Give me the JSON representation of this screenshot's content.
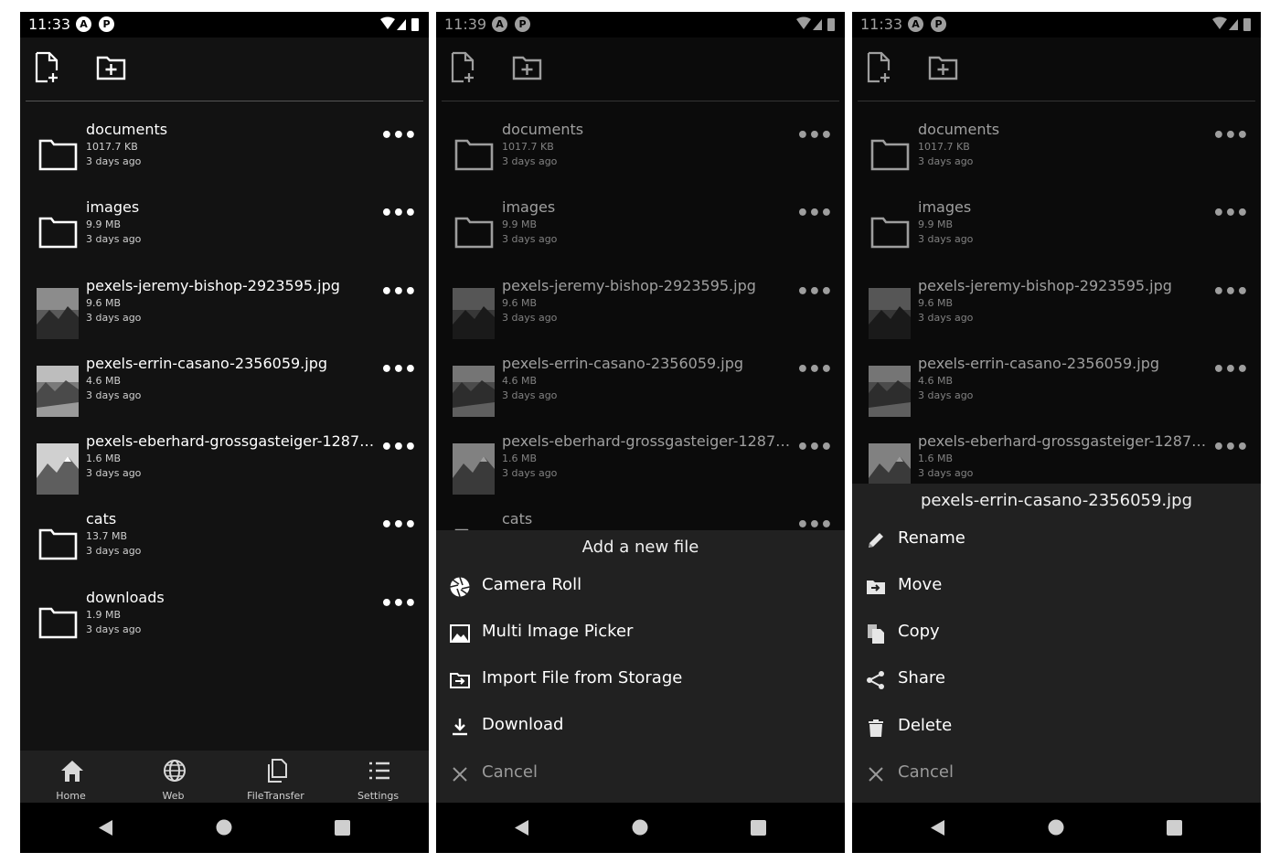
{
  "phones": [
    {
      "time": "11:33",
      "files": [
        {
          "name": "documents",
          "size": "1017.7 KB",
          "date": "3 days ago",
          "kind": "folder"
        },
        {
          "name": "images",
          "size": "9.9 MB",
          "date": "3 days ago",
          "kind": "folder"
        },
        {
          "name": "pexels-jeremy-bishop-2923595.jpg",
          "size": "9.6 MB",
          "date": "3 days ago",
          "kind": "image"
        },
        {
          "name": "pexels-errin-casano-2356059.jpg",
          "size": "4.6 MB",
          "date": "3 days ago",
          "kind": "image"
        },
        {
          "name": "pexels-eberhard-grossgasteiger-1287…",
          "size": "1.6 MB",
          "date": "3 days ago",
          "kind": "image"
        },
        {
          "name": "cats",
          "size": "13.7 MB",
          "date": "3 days ago",
          "kind": "folder"
        },
        {
          "name": "downloads",
          "size": "1.9 MB",
          "date": "3 days ago",
          "kind": "folder"
        }
      ],
      "nav": [
        {
          "label": "Home",
          "icon": "home-icon"
        },
        {
          "label": "Web",
          "icon": "globe-icon"
        },
        {
          "label": "FileTransfer",
          "icon": "files-icon"
        },
        {
          "label": "Settings",
          "icon": "list-icon"
        }
      ]
    },
    {
      "time": "11:39",
      "files": [
        {
          "name": "documents",
          "size": "1017.7 KB",
          "date": "3 days ago",
          "kind": "folder"
        },
        {
          "name": "images",
          "size": "9.9 MB",
          "date": "3 days ago",
          "kind": "folder"
        },
        {
          "name": "pexels-jeremy-bishop-2923595.jpg",
          "size": "9.6 MB",
          "date": "3 days ago",
          "kind": "image"
        },
        {
          "name": "pexels-errin-casano-2356059.jpg",
          "size": "4.6 MB",
          "date": "3 days ago",
          "kind": "image"
        },
        {
          "name": "pexels-eberhard-grossgasteiger-1287…",
          "size": "1.6 MB",
          "date": "3 days ago",
          "kind": "image"
        },
        {
          "name": "cats",
          "size": "",
          "date": "",
          "kind": "folder"
        }
      ],
      "sheet": {
        "title": "Add a new file",
        "items": [
          {
            "label": "Camera Roll",
            "icon": "aperture-icon"
          },
          {
            "label": "Multi Image Picker",
            "icon": "image-icon"
          },
          {
            "label": "Import File from Storage",
            "icon": "folder-import-icon"
          },
          {
            "label": "Download",
            "icon": "download-icon"
          },
          {
            "label": "Cancel",
            "icon": "close-icon"
          }
        ]
      }
    },
    {
      "time": "11:33",
      "files": [
        {
          "name": "documents",
          "size": "1017.7 KB",
          "date": "3 days ago",
          "kind": "folder"
        },
        {
          "name": "images",
          "size": "9.9 MB",
          "date": "3 days ago",
          "kind": "folder"
        },
        {
          "name": "pexels-jeremy-bishop-2923595.jpg",
          "size": "9.6 MB",
          "date": "3 days ago",
          "kind": "image"
        },
        {
          "name": "pexels-errin-casano-2356059.jpg",
          "size": "4.6 MB",
          "date": "3 days ago",
          "kind": "image"
        },
        {
          "name": "pexels-eberhard-grossgasteiger-1287…",
          "size": "1.6 MB",
          "date": "3 days ago",
          "kind": "image"
        }
      ],
      "sheet": {
        "title": "pexels-errin-casano-2356059.jpg",
        "items": [
          {
            "label": "Rename",
            "icon": "pencil-icon"
          },
          {
            "label": "Move",
            "icon": "folder-move-icon"
          },
          {
            "label": "Copy",
            "icon": "copy-icon"
          },
          {
            "label": "Share",
            "icon": "share-icon"
          },
          {
            "label": "Delete",
            "icon": "trash-icon"
          },
          {
            "label": "Cancel",
            "icon": "close-icon"
          }
        ]
      }
    }
  ]
}
